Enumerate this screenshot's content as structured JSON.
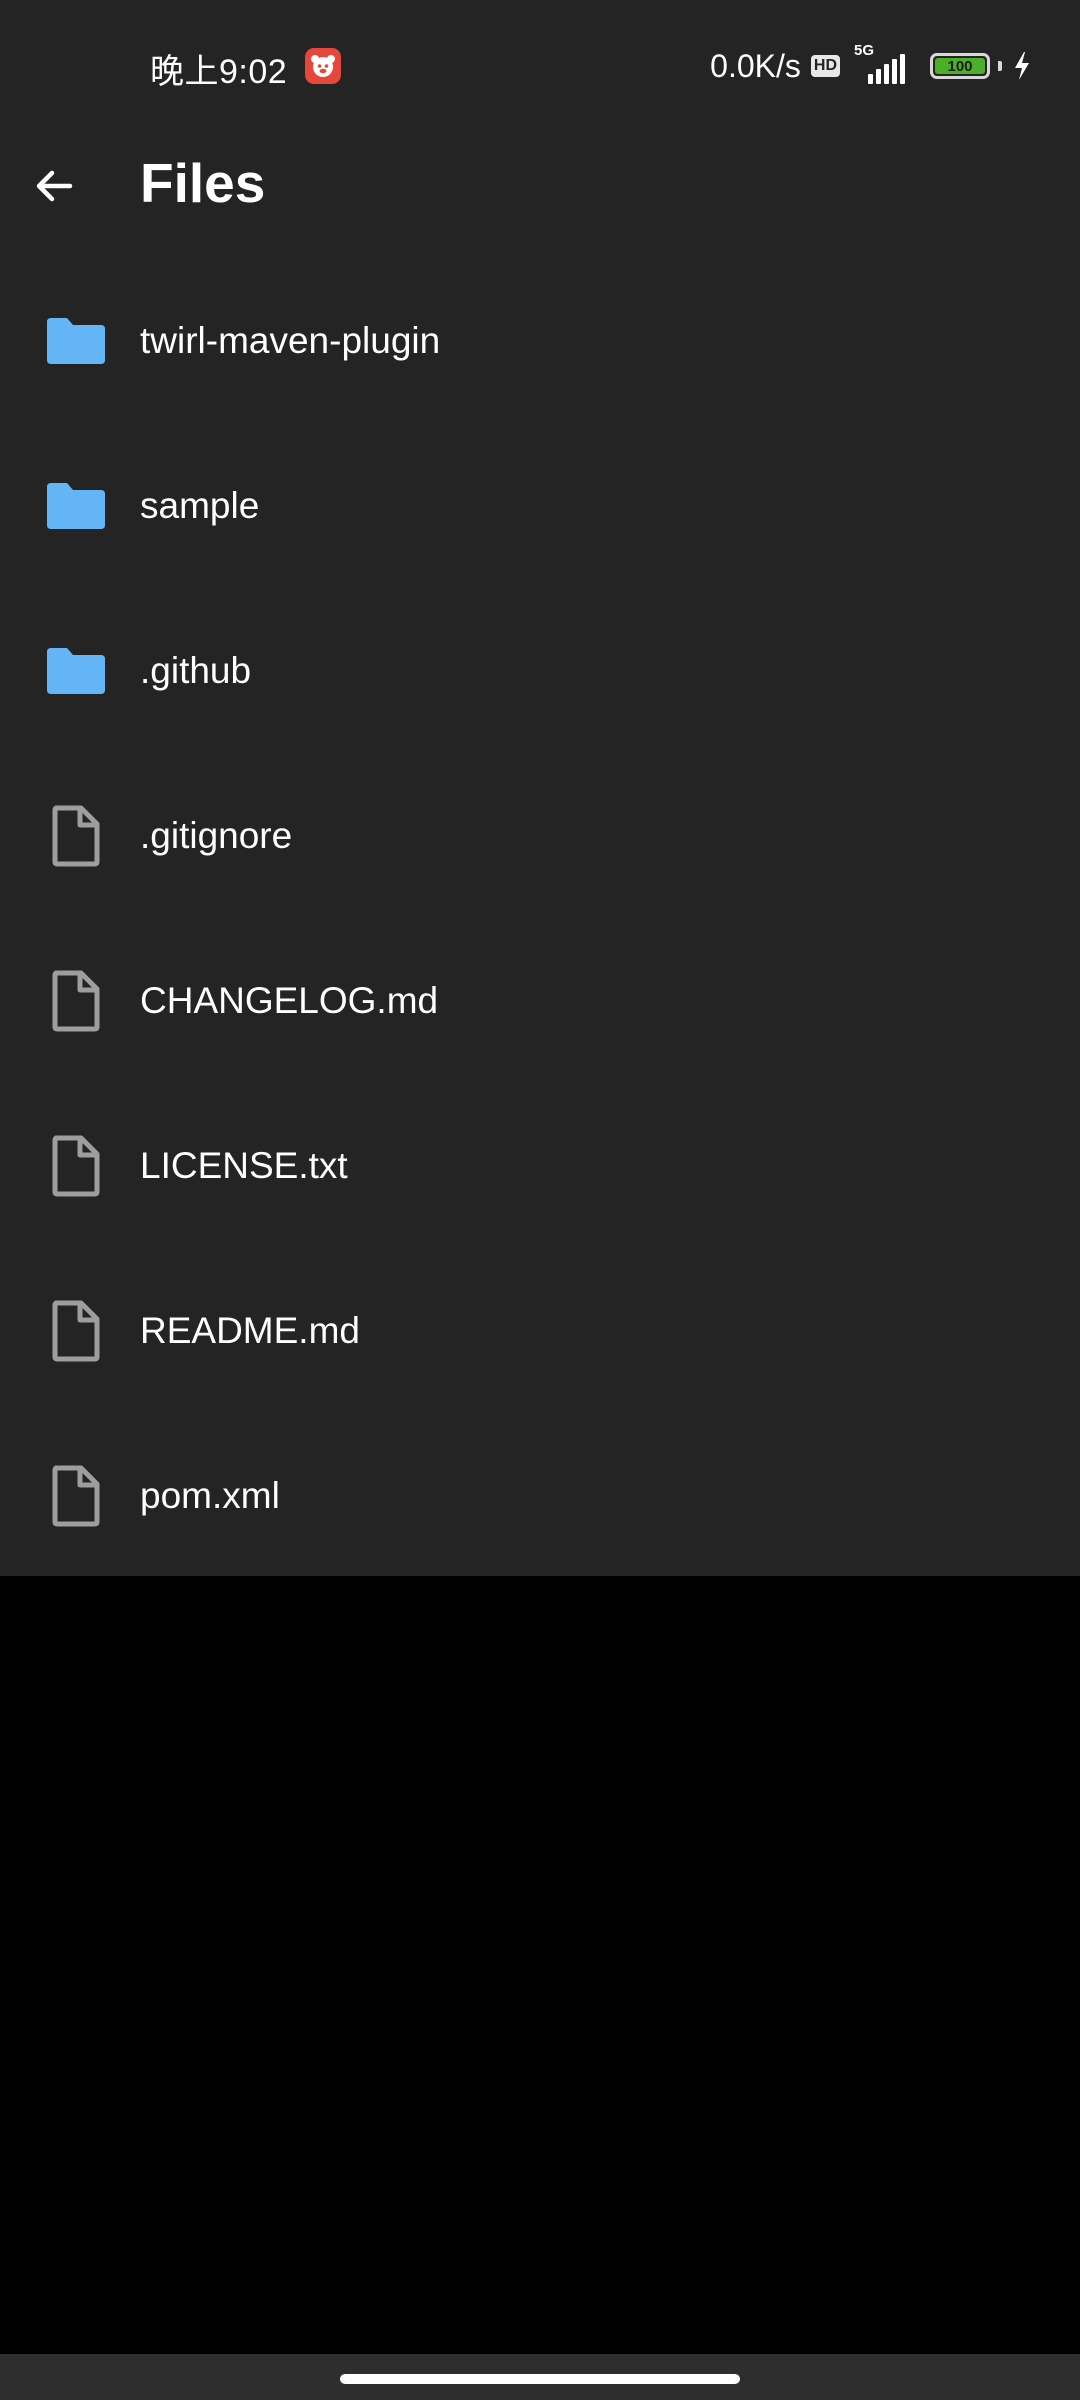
{
  "status_bar": {
    "time": "晚上9:02",
    "net_speed": "0.0K/s",
    "hd_badge": "HD",
    "network_type": "5G",
    "battery_level": "100",
    "battery_color": "#4caf2a",
    "notification_icon": "app-notification-icon",
    "charging_icon": "lightning-bolt-icon"
  },
  "toolbar": {
    "back_icon": "arrow-back-icon",
    "title": "Files"
  },
  "colors": {
    "app_background": "#242424",
    "folder_icon": "#64b5f6",
    "file_icon": "#9e9e9e",
    "text": "#ffffff"
  },
  "files": [
    {
      "name": "twirl-maven-plugin",
      "type": "folder",
      "icon": "folder-icon"
    },
    {
      "name": "sample",
      "type": "folder",
      "icon": "folder-icon"
    },
    {
      "name": ".github",
      "type": "folder",
      "icon": "folder-icon"
    },
    {
      "name": ".gitignore",
      "type": "file",
      "icon": "file-icon"
    },
    {
      "name": "CHANGELOG.md",
      "type": "file",
      "icon": "file-icon"
    },
    {
      "name": "LICENSE.txt",
      "type": "file",
      "icon": "file-icon"
    },
    {
      "name": "README.md",
      "type": "file",
      "icon": "file-icon"
    },
    {
      "name": "pom.xml",
      "type": "file",
      "icon": "file-icon"
    }
  ]
}
